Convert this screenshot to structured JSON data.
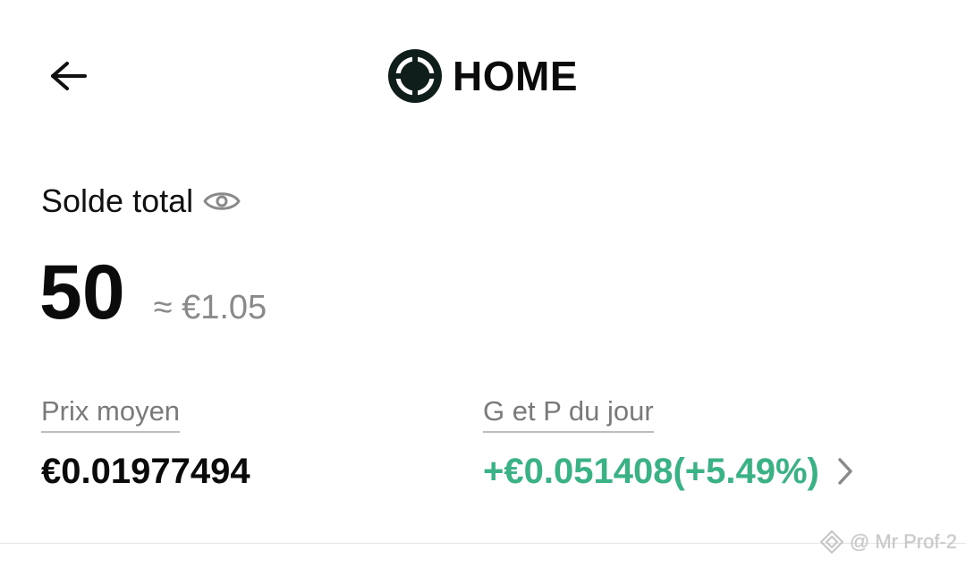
{
  "header": {
    "title": "HOME",
    "logo_icon": "target-coin-icon",
    "back_icon": "arrow-left-icon"
  },
  "balance": {
    "label": "Solde total",
    "visibility_icon": "eye-icon",
    "amount": "50",
    "fiat_estimate": "≈ €1.05"
  },
  "stats": {
    "average_price": {
      "label": "Prix moyen",
      "value": "€0.01977494"
    },
    "daily_pnl": {
      "label": "G et P du jour",
      "value": "+€0.051408(+5.49%)",
      "chevron_icon": "chevron-right-icon"
    }
  },
  "watermark": {
    "text": "@ Mr Prof-2",
    "icon": "binance-diamond-icon"
  },
  "colors": {
    "positive": "#3bb286",
    "muted": "#8a8a8a",
    "primary_text": "#0b0b0b"
  }
}
